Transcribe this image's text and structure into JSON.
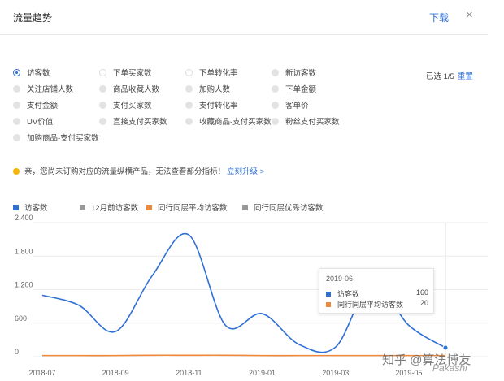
{
  "header": {
    "title": "流量趋势",
    "download_label": "下载",
    "close_icon": "×"
  },
  "metrics": [
    {
      "label": "访客数",
      "state": "selected"
    },
    {
      "label": "下单买家数",
      "state": "empty"
    },
    {
      "label": "下单转化率",
      "state": "empty"
    },
    {
      "label": "新访客数",
      "state": "off"
    },
    {
      "label": "关注店铺人数",
      "state": "off"
    },
    {
      "label": "商品收藏人数",
      "state": "off"
    },
    {
      "label": "加购人数",
      "state": "off"
    },
    {
      "label": "下单金额",
      "state": "off"
    },
    {
      "label": "支付金额",
      "state": "off"
    },
    {
      "label": "支付买家数",
      "state": "off"
    },
    {
      "label": "支付转化率",
      "state": "off"
    },
    {
      "label": "客单价",
      "state": "off"
    },
    {
      "label": "UV价值",
      "state": "off"
    },
    {
      "label": "直接支付买家数",
      "state": "off"
    },
    {
      "label": "收藏商品-支付买家数",
      "state": "off"
    },
    {
      "label": "粉丝支付买家数",
      "state": "off"
    },
    {
      "label": "加购商品-支付买家数",
      "state": "off"
    }
  ],
  "selection": {
    "text": "已选 1/5",
    "reset_label": "重置"
  },
  "notice": {
    "text": "亲，您尚未订购对应的流量纵横产品，无法查看部分指标！",
    "link": "立刻升级 >"
  },
  "legend": [
    {
      "label": "访客数",
      "color": "#2f6fd6"
    },
    {
      "label": "12月前访客数",
      "color": "#999999"
    },
    {
      "label": "同行同层平均访客数",
      "color": "#f0883a"
    },
    {
      "label": "同行同层优秀访客数",
      "color": "#999999"
    }
  ],
  "tooltip": {
    "date": "2019-06",
    "rows": [
      {
        "label": "访客数",
        "value": "160",
        "color": "#2f6fd6"
      },
      {
        "label": "同行同层平均访客数",
        "value": "20",
        "color": "#f0883a"
      }
    ]
  },
  "watermark": "知乎 @算法博友",
  "watermark2": "Pakashi",
  "chart_data": {
    "type": "line",
    "x": [
      "2018-07",
      "2018-08",
      "2018-09",
      "2018-10",
      "2018-11",
      "2018-12",
      "2019-01",
      "2019-02",
      "2019-03",
      "2019-04",
      "2019-05",
      "2019-06"
    ],
    "x_tick_labels": [
      "2018-07",
      "2018-09",
      "2018-11",
      "2019-01",
      "2019-03",
      "2019-05"
    ],
    "y_ticks": [
      0,
      600,
      1200,
      1800,
      2400
    ],
    "ylim": [
      0,
      2400
    ],
    "series": [
      {
        "name": "访客数",
        "color": "#2f6fd6",
        "values": [
          1100,
          920,
          450,
          1450,
          2180,
          560,
          770,
          220,
          170,
          1330,
          560,
          160
        ]
      },
      {
        "name": "同行同层平均访客数",
        "color": "#f0883a",
        "values": [
          20,
          20,
          20,
          25,
          25,
          25,
          20,
          20,
          20,
          20,
          20,
          20
        ]
      }
    ],
    "grid": "horizontal"
  }
}
